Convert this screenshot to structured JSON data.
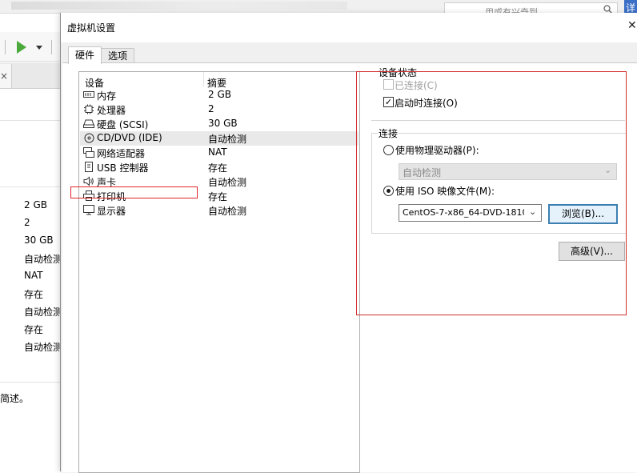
{
  "background_window": {
    "search_placeholder": "用或有兴奇到",
    "corner_button_label": "详",
    "values": [
      "2 GB",
      "2",
      "30 GB",
      "自动检测",
      "NAT",
      "存在",
      "自动检测",
      "存在",
      "自动检测"
    ],
    "description_fragment": "简述。"
  },
  "dialog": {
    "title": "虚拟机设置",
    "tabs": [
      {
        "label": "硬件"
      },
      {
        "label": "选项"
      }
    ],
    "device_list": {
      "header_device": "设备",
      "header_summary": "摘要",
      "items": [
        {
          "name": "内存",
          "summary": "2 GB",
          "icon": "memory-icon"
        },
        {
          "name": "处理器",
          "summary": "2",
          "icon": "cpu-icon"
        },
        {
          "name": "硬盘 (SCSI)",
          "summary": "30 GB",
          "icon": "hard-disk-icon"
        },
        {
          "name": "CD/DVD (IDE)",
          "summary": "自动检测",
          "icon": "cd-dvd-icon"
        },
        {
          "name": "网络适配器",
          "summary": "NAT",
          "icon": "network-adapter-icon"
        },
        {
          "name": "USB 控制器",
          "summary": "存在",
          "icon": "usb-icon"
        },
        {
          "name": "声卡",
          "summary": "自动检测",
          "icon": "sound-card-icon"
        },
        {
          "name": "打印机",
          "summary": "存在",
          "icon": "printer-icon"
        },
        {
          "name": "显示器",
          "summary": "自动检测",
          "icon": "display-icon"
        }
      ],
      "selected_index": 3
    },
    "device_status": {
      "title": "设备状态",
      "connected_label": "已连接(C)",
      "connect_at_power_on_label": "启动时连接(O)",
      "connected": false,
      "connect_at_power_on": true
    },
    "connection": {
      "title": "连接",
      "physical_drive_label": "使用物理驱动器(P):",
      "physical_drive_value": "自动检测",
      "iso_label": "使用 ISO 映像文件(M):",
      "iso_value": "CentOS-7-x86_64-DVD-1810",
      "browse_label": "浏览(B)...",
      "selected": "iso"
    },
    "advanced_label": "高级(V)..."
  },
  "colors": {
    "highlight_red": "#e0262b",
    "play_green": "#4aa93a",
    "focus_blue": "#3c7fb1"
  }
}
